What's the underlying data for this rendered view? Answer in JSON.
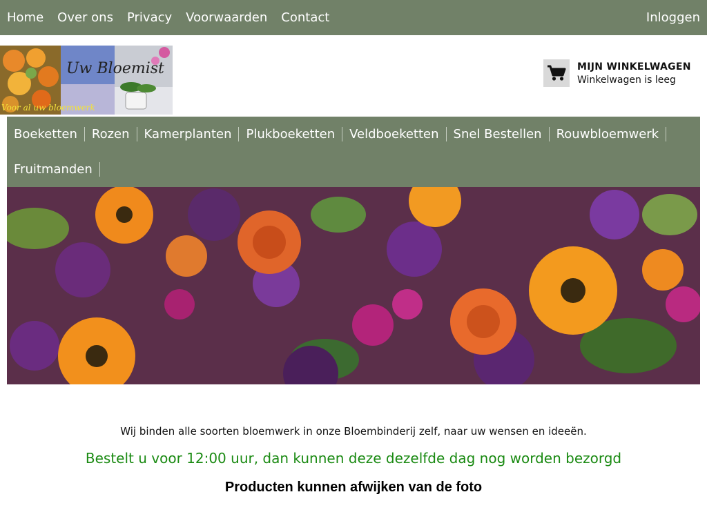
{
  "top_nav": {
    "items": [
      "Home",
      "Over ons",
      "Privacy",
      "Voorwaarden",
      "Contact"
    ],
    "login": "Inloggen"
  },
  "logo": {
    "text_main": "Uw Bloemist",
    "text_sub": "Voor al uw bloemwerk"
  },
  "cart": {
    "title": "MIJN WINKELWAGEN",
    "status": "Winkelwagen is leeg",
    "icon": "shopping-cart-icon"
  },
  "category_nav": {
    "row1": [
      "Boeketten",
      "Rozen",
      "Kamerplanten",
      "Plukboeketten",
      "Veldboeketten",
      "Snel Bestellen",
      "Rouwbloemwerk"
    ],
    "row2": [
      "Fruitmanden"
    ]
  },
  "content": {
    "intro": "Wij binden alle soorten bloemwerk in onze Bloembinderij zelf, naar uw wensen en ideeën.",
    "order_notice": "Bestelt u voor 12:00 uur, dan kunnen deze dezelfde dag nog worden bezorgd",
    "disclaimer": "Producten kunnen afwijken van de foto"
  },
  "colors": {
    "nav_bg": "#718168",
    "order_notice": "#1a8a12"
  }
}
